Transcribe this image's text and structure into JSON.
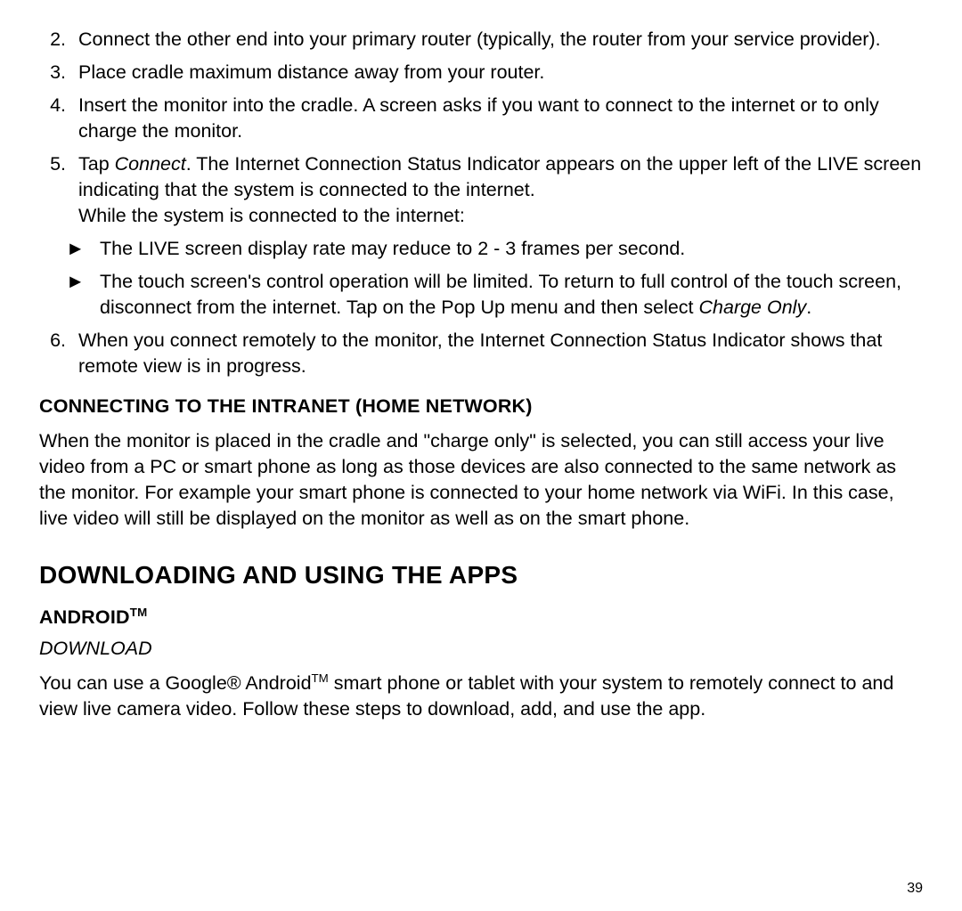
{
  "steps": [
    {
      "n": "2.",
      "text": "Connect the other end into your primary router (typically, the router from your service provider)."
    },
    {
      "n": "3.",
      "text": "Place cradle maximum distance away from your router."
    },
    {
      "n": "4.",
      "text": "Insert the monitor into the cradle.  A screen asks if you want to connect to the internet or to only charge the monitor."
    },
    {
      "n": "5.",
      "pre": "Tap ",
      "em": "Connect",
      "post": ". The Internet Connection Status Indicator appears on the upper left of the LIVE screen indicating that the system is connected to the internet.",
      "line2": "While the system is connected to the internet:"
    },
    {
      "n": "6.",
      "text": "When you connect remotely to the monitor, the Internet Connection Status Indicator shows that remote view is in progress."
    }
  ],
  "bullets": [
    {
      "mark": "►",
      "text": "The LIVE screen display rate may reduce to 2 - 3 frames per second."
    },
    {
      "mark": "►",
      "pre": "The touch screen's control operation will be limited. To return to full control of the touch screen, disconnect from the internet. Tap on the Pop Up menu and then select ",
      "em": "Charge Only",
      "post": "."
    }
  ],
  "intranet": {
    "heading": "CONNECTING TO THE INTRANET (HOME NETWORK)",
    "body": "When the monitor is placed in the cradle and \"charge only\" is selected, you can still access your live video from a PC or smart phone as long as those devices are also connected to the same network as the monitor.  For example your smart phone is connected to your home network via WiFi.  In this case, live video will still be displayed on the monitor as well as on the smart phone."
  },
  "apps": {
    "heading": "DOWNLOADING AND USING THE APPS",
    "android_label": "ANDROID",
    "android_tm": "TM",
    "download_label": "DOWNLOAD",
    "body_pre": "You can use a Google® Android",
    "body_tm": "TM",
    "body_post": " smart phone or tablet with your system to remotely connect to and view live camera video. Follow these steps to download, add, and use the app."
  },
  "page_number": "39"
}
